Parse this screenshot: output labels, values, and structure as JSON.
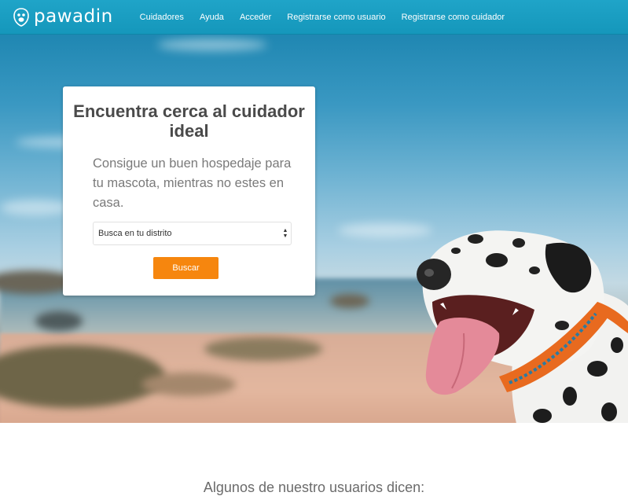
{
  "brand": {
    "name": "pawadin",
    "icon": "paw-badge-icon"
  },
  "nav": {
    "items": [
      {
        "label": "Cuidadores"
      },
      {
        "label": "Ayuda"
      },
      {
        "label": "Acceder"
      },
      {
        "label": "Registrarse como usuario"
      },
      {
        "label": "Registrarse como cuidador"
      }
    ]
  },
  "hero": {
    "card": {
      "title": "Encuentra cerca al cuidador ideal",
      "subtitle": "Consigue un buen hospedaje para tu mascota, mientras no estes en casa.",
      "select_value": "Busca en tu distrito",
      "search_label": "Buscar"
    }
  },
  "testimonials": {
    "heading": "Algunos de nuestro usuarios dicen:"
  },
  "colors": {
    "navbar": "#1a9dc2",
    "accent": "#f6860e",
    "title_text": "#4a4a4a"
  }
}
